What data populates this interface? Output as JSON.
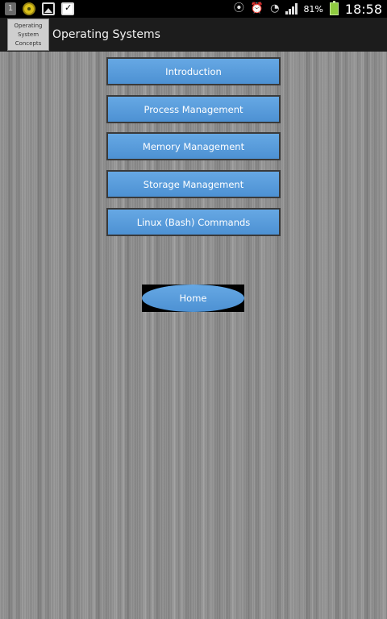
{
  "status_bar": {
    "notification_count": "1",
    "battery_percent": "81%",
    "time": "18:58",
    "icons": [
      "notification-count-icon",
      "coin-icon",
      "gallery-icon",
      "clipboard-check-icon",
      "vibrate-icon",
      "alarm-icon",
      "wifi-icon",
      "signal-icon",
      "battery-icon"
    ]
  },
  "action_bar": {
    "logo_lines": [
      "Operating",
      "System",
      "Concepts"
    ],
    "title": "Operating Systems"
  },
  "menu": {
    "items": [
      {
        "label": "Introduction"
      },
      {
        "label": "Process Management"
      },
      {
        "label": "Memory Management"
      },
      {
        "label": "Storage Management"
      },
      {
        "label": "Linux (Bash) Commands"
      }
    ],
    "home_label": "Home"
  },
  "colors": {
    "button_blue": "#559adb",
    "status_bar": "#000000",
    "action_bar": "#1c1c1c",
    "battery": "#8fcc3f"
  }
}
